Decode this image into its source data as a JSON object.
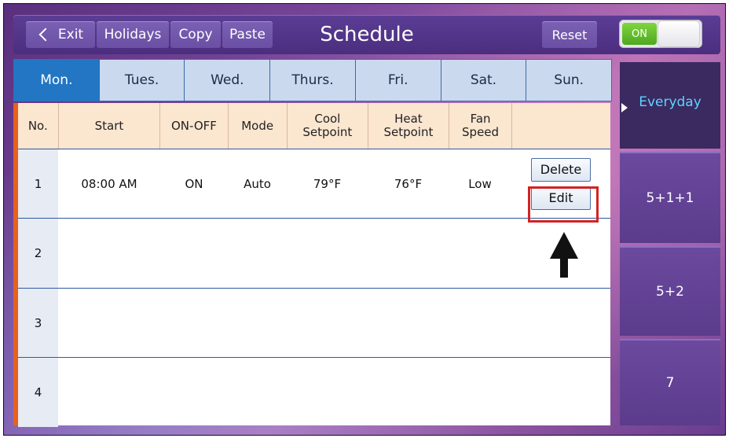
{
  "topbar": {
    "exit_label": "Exit",
    "holidays_label": "Holidays",
    "copy_label": "Copy",
    "paste_label": "Paste",
    "title": "Schedule",
    "reset_label": "Reset",
    "toggle_label": "ON"
  },
  "days": [
    "Mon.",
    "Tues.",
    "Wed.",
    "Thurs.",
    "Fri.",
    "Sat.",
    "Sun."
  ],
  "active_day": "Mon.",
  "table": {
    "headers": {
      "no": "No.",
      "start": "Start",
      "onoff": "ON-OFF",
      "mode": "Mode",
      "cool": "Cool\nSetpoint",
      "heat": "Heat\nSetpoint",
      "fan": "Fan\nSpeed"
    },
    "rows": [
      {
        "no": "1",
        "start": "08:00 AM",
        "onoff": "ON",
        "mode": "Auto",
        "cool": "79°F",
        "heat": "76°F",
        "fan": "Low"
      },
      {
        "no": "2",
        "start": "",
        "onoff": "",
        "mode": "",
        "cool": "",
        "heat": "",
        "fan": ""
      },
      {
        "no": "3",
        "start": "",
        "onoff": "",
        "mode": "",
        "cool": "",
        "heat": "",
        "fan": ""
      },
      {
        "no": "4",
        "start": "",
        "onoff": "",
        "mode": "",
        "cool": "",
        "heat": "",
        "fan": ""
      }
    ],
    "delete_label": "Delete",
    "edit_label": "Edit"
  },
  "sidebar": {
    "items": [
      "Everyday",
      "5+1+1",
      "5+2",
      "7"
    ],
    "active": "Everyday"
  },
  "colors": {
    "accent_tab": "#2276c4",
    "highlight": "#d32323",
    "active_mode_text": "#5fd3ff",
    "toggle_on": "#4ea81e"
  },
  "icons": {
    "back": "chevron-left-icon",
    "pointer": "arrow-up-icon"
  }
}
